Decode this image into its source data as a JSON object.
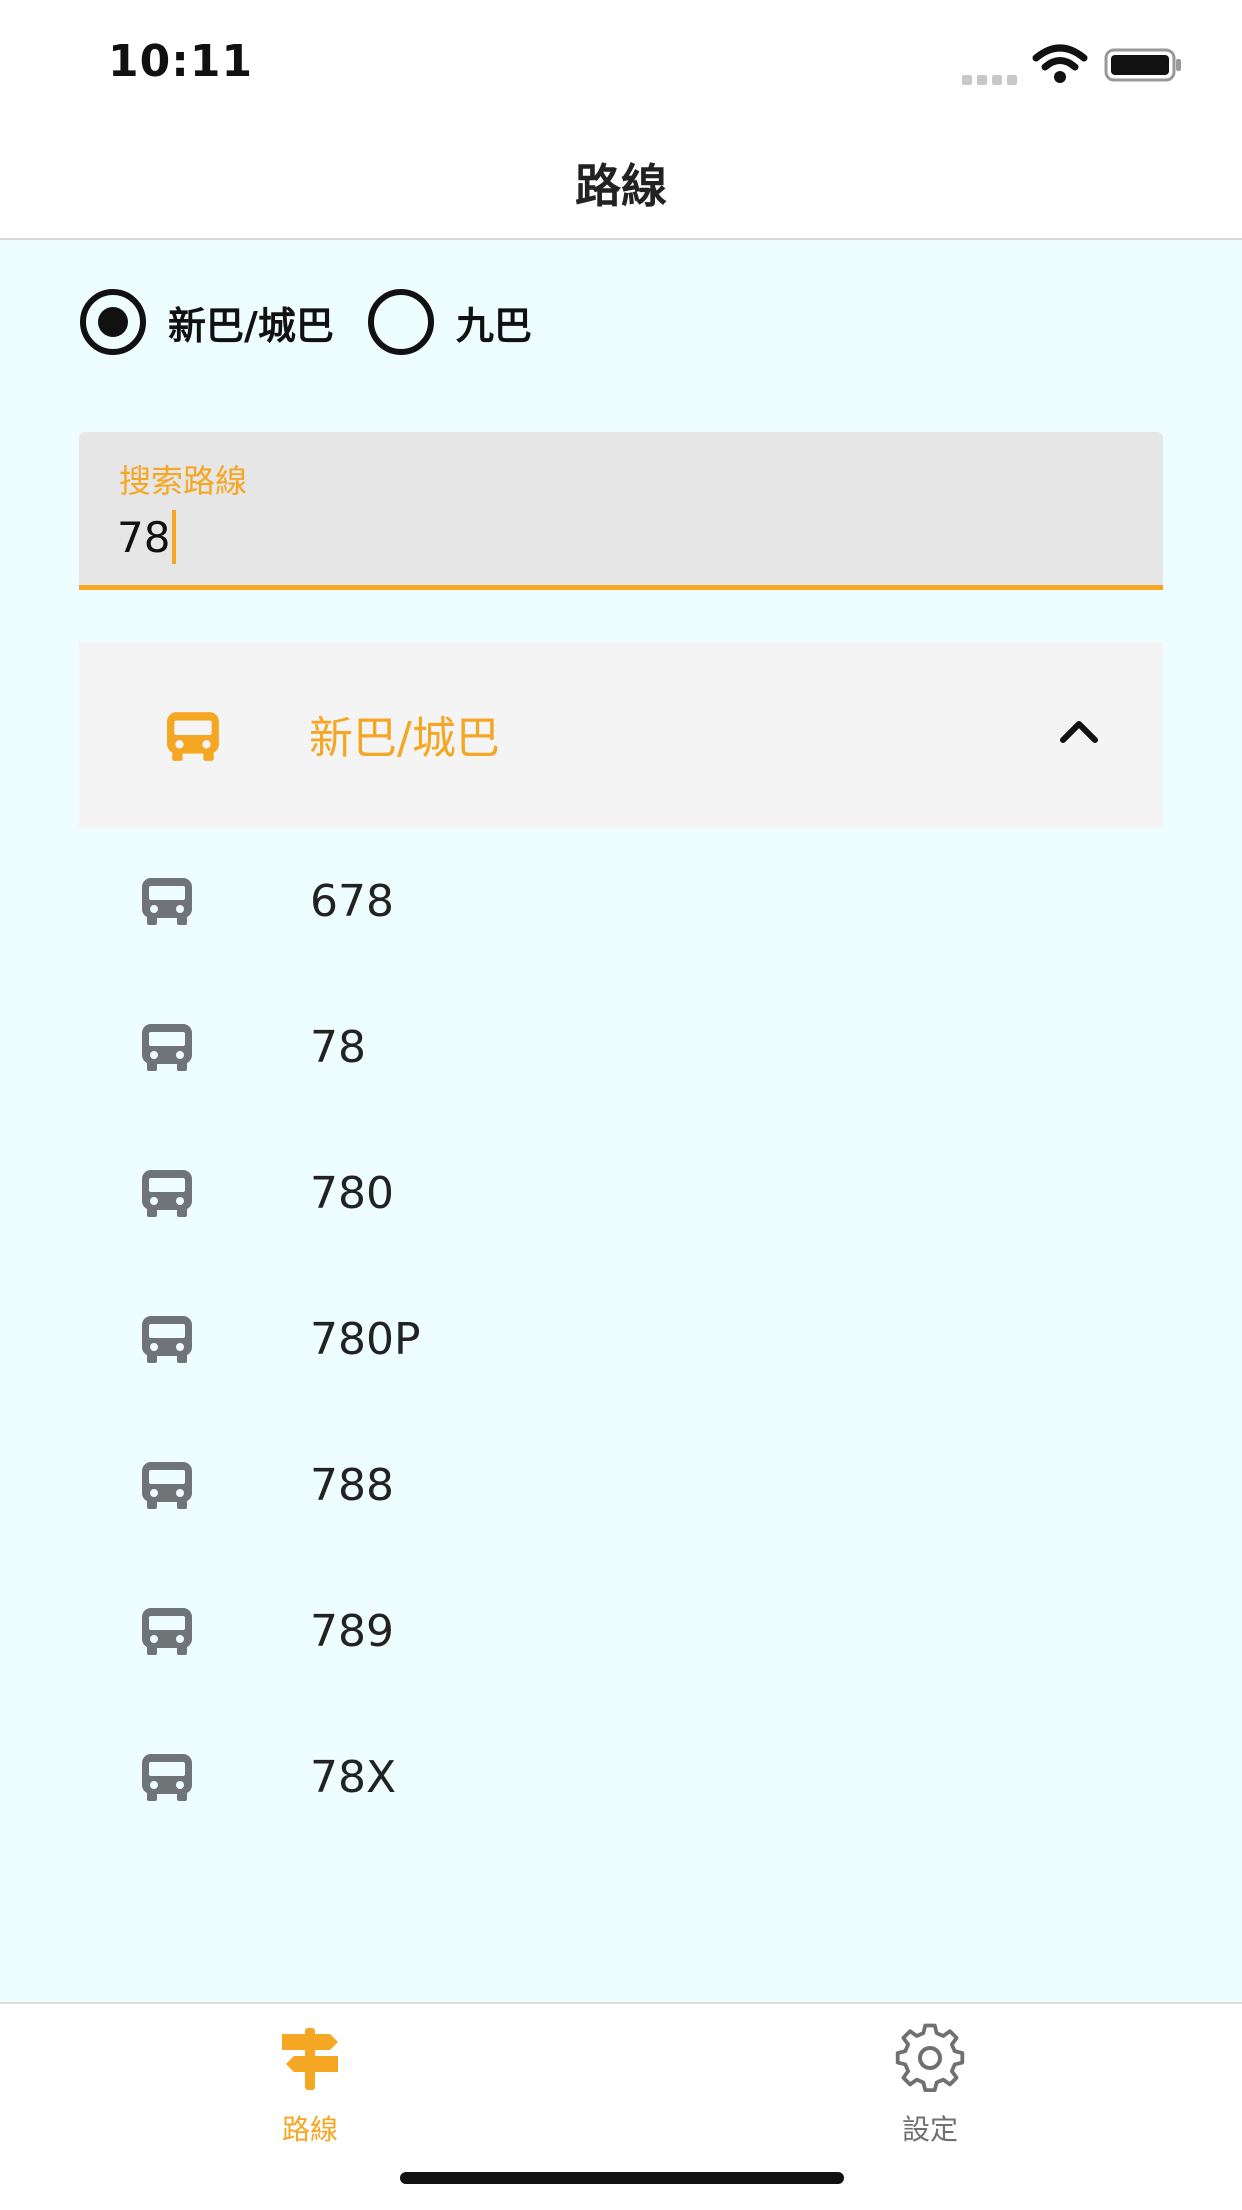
{
  "status_bar": {
    "time": "10:11"
  },
  "nav": {
    "title": "路線"
  },
  "operators": [
    {
      "label": "新巴/城巴",
      "selected": true
    },
    {
      "label": "九巴",
      "selected": false
    }
  ],
  "search": {
    "label": "搜索路線",
    "value": "78"
  },
  "group": {
    "label": "新巴/城巴",
    "expanded": true
  },
  "routes": [
    "678",
    "78",
    "780",
    "780P",
    "788",
    "789",
    "78X"
  ],
  "tabs": [
    {
      "label": "路線",
      "icon": "signpost-icon",
      "active": true
    },
    {
      "label": "設定",
      "icon": "gear-icon",
      "active": false
    }
  ],
  "colors": {
    "accent": "#f5a623",
    "content_bg": "#eefeff",
    "icon_gray": "#6f7477"
  }
}
